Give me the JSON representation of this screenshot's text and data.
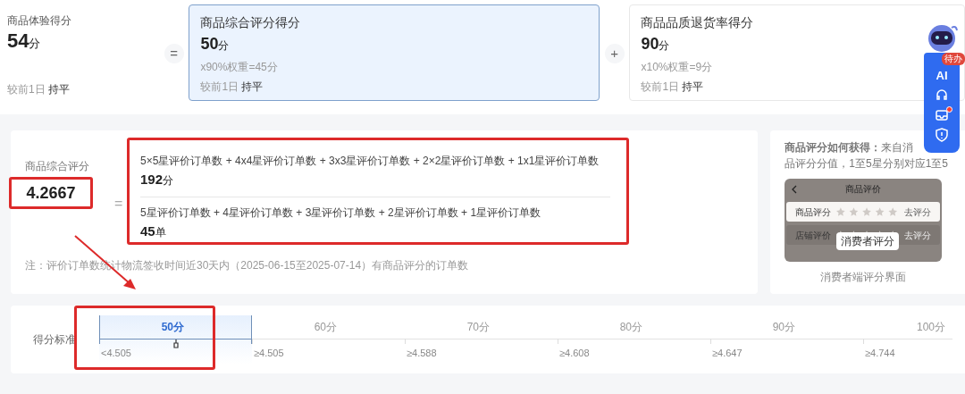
{
  "summary": {
    "label": "商品体验得分",
    "value": "54",
    "unit": "分",
    "compare_label": "较前1日",
    "compare_value": "持平"
  },
  "components": [
    {
      "operator": "=",
      "title": "商品综合评分得分",
      "value": "50",
      "unit": "分",
      "weight": "x90%权重=45分",
      "compare_label": "较前1日",
      "compare_value": "持平",
      "selected": true
    },
    {
      "operator": "+",
      "title": "商品品质退货率得分",
      "value": "90",
      "unit": "分",
      "weight": "x10%权重=9分",
      "compare_label": "较前1日",
      "compare_value": "持平",
      "selected": false
    }
  ],
  "assistant": {
    "badge": "待办",
    "ai_label": "AI",
    "inbox_alert": true
  },
  "formula": {
    "label": "商品综合评分",
    "value": "4.2667",
    "operator": "=",
    "numerator": "5×5星评价订单数 + 4x4星评价订单数 + 3x3星评价订单数 + 2×2星评价订单数 + 1x1星评价订单数",
    "numerator_value": "192",
    "numerator_unit": "分",
    "denominator": "5星评价订单数 + 4星评价订单数 + 3星评价订单数 + 2星评价订单数 + 1星评价订单数",
    "denominator_value": "45",
    "denominator_unit": "单",
    "note": "注：评价订单数统计物流签收时间近30天内（2025-06-15至2025-07-14）有商品评分的订单数"
  },
  "how_to": {
    "lines": [
      "**商品评分如何获得：**来自消",
      "品评分分值，1至5星分别对应1至5"
    ],
    "preview": {
      "title": "商品评价",
      "rows": [
        {
          "label": "商品评分",
          "action": "去评分",
          "selected": true
        },
        {
          "label": "店铺评价",
          "action": "去评分",
          "selected": false
        }
      ],
      "tooltip": "消费者评分"
    },
    "caption": "消费者端评分界面"
  },
  "scale": {
    "label": "得分标准",
    "levels": [
      {
        "score": "50分",
        "threshold": "<4.505",
        "selected": true
      },
      {
        "score": "60分",
        "threshold": "≥4.505",
        "selected": false
      },
      {
        "score": "70分",
        "threshold": "≥4.588",
        "selected": false
      },
      {
        "score": "80分",
        "threshold": "≥4.608",
        "selected": false
      },
      {
        "score": "90分",
        "threshold": "≥4.647",
        "selected": false
      },
      {
        "score": "100分",
        "threshold": "≥4.744",
        "selected": false
      }
    ]
  }
}
